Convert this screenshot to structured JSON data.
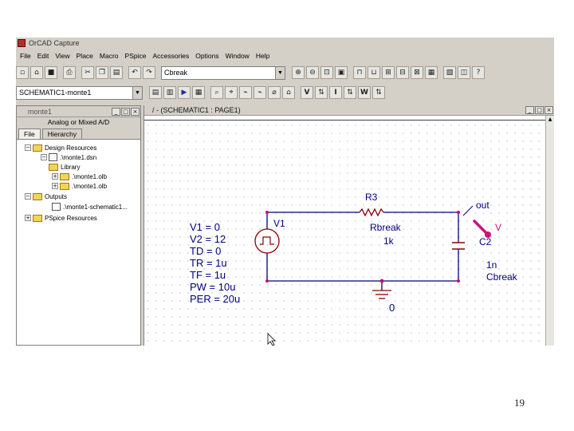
{
  "window_title": "OrCAD Capture",
  "menu": [
    "File",
    "Edit",
    "View",
    "Place",
    "Macro",
    "PSpice",
    "Accessories",
    "Options",
    "Window",
    "Help"
  ],
  "toolbar1": {
    "part_combo_value": "Cbreak"
  },
  "toolbar2": {
    "schematic_combo_value": "SCHEMATIC1-monte1",
    "letter_buttons": [
      "V",
      "I",
      "W"
    ]
  },
  "project_panel": {
    "title": "monte1",
    "subtitle": "Analog or Mixed A/D",
    "tabs": [
      "File",
      "Hierarchy"
    ],
    "tree": [
      {
        "label": "Design Resources"
      },
      {
        "label": ".\\monte1.dsn"
      },
      {
        "label": "Library"
      },
      {
        "label": ".\\monte1.olb"
      },
      {
        "label": ".\\monte1.olb"
      },
      {
        "label": "Outputs"
      },
      {
        "label": ".\\monte1-schematic1..."
      },
      {
        "label": "PSpice Resources"
      }
    ]
  },
  "schematic_window": {
    "title": "/ - (SCHEMATIC1 : PAGE1)",
    "source": {
      "ref": "V1",
      "params": [
        "V1 = 0",
        "V2 = 12",
        "TD = 0",
        "TR = 1u",
        "TF = 1u",
        "PW = 10u",
        "PER = 20u"
      ]
    },
    "resistor": {
      "ref": "R3",
      "part": "Rbreak",
      "value": "1k"
    },
    "capacitor": {
      "ref": "C2",
      "value": "1n",
      "part": "Cbreak"
    },
    "net_label": "out",
    "probe_label": "V",
    "ground_label": "0"
  },
  "slide_number": "19",
  "colors": {
    "wire": "#000080",
    "component": "#8b0000",
    "node": "#c01070",
    "probe": "#d0107a",
    "grid_dot": "#b8c0cc"
  }
}
